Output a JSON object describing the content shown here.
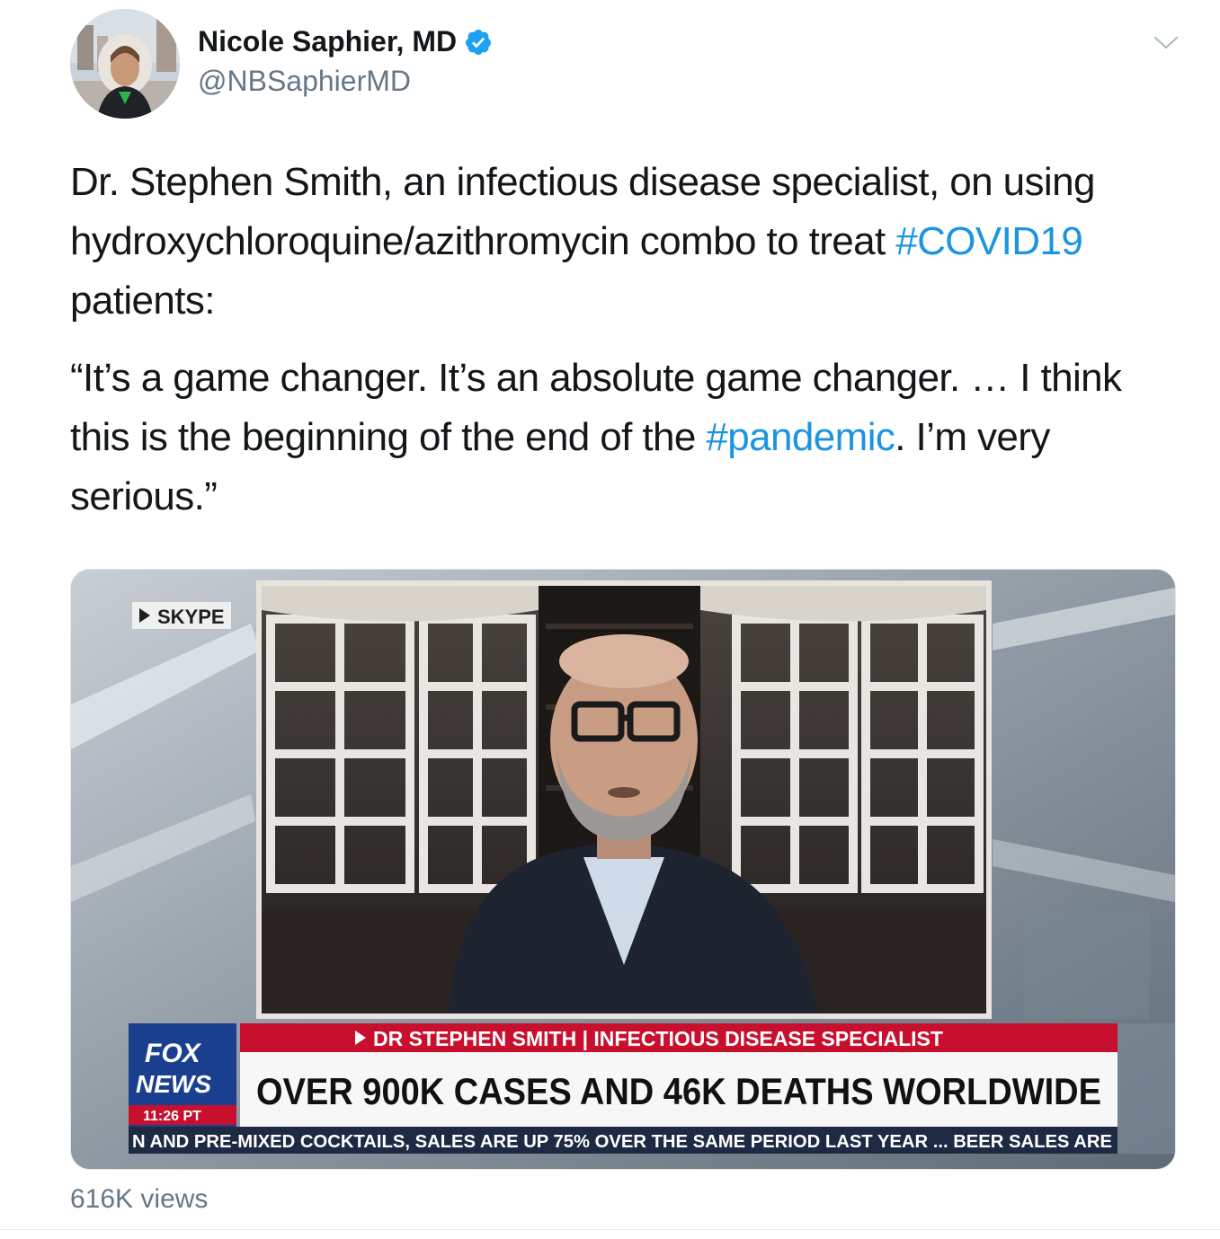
{
  "author": {
    "display_name": "Nicole Saphier, MD",
    "handle": "@NBSaphierMD",
    "verified": true
  },
  "tweet": {
    "p1_a": "Dr. Stephen Smith, an infectious disease specialist, on using hydroxychloroquine/azithromycin combo to treat ",
    "hashtag1": "#COVID19",
    "p1_b": " patients:",
    "p2_a": "“It’s a game changer. It’s an absolute game changer. … I think this is the beginning of the end of the ",
    "hashtag2": "#pandemic",
    "p2_b": ". I’m very serious.”"
  },
  "media": {
    "source_tag": "SKYPE",
    "logo_line1": "FOX",
    "logo_line2": "NEWS",
    "clock": "11:26 PT",
    "name_strap": "DR STEPHEN SMITH | INFECTIOUS DISEASE SPECIALIST",
    "headline": "OVER 900K CASES AND 46K DEATHS WORLDWIDE",
    "ticker": "N AND PRE-MIXED COCKTAILS, SALES ARE UP 75% OVER THE SAME PERIOD LAST YEAR ...  BEER SALES ARE"
  },
  "footer": {
    "views": "616K views"
  },
  "colors": {
    "link": "#1b95e0",
    "muted": "#657786",
    "verified_badge": "#1da1f2",
    "fox_blue": "#1b3f8f",
    "fox_red": "#c8102e"
  },
  "icons": {
    "verified": "verified-badge-icon",
    "menu": "chevron-down-icon",
    "play": "play-triangle-icon"
  }
}
